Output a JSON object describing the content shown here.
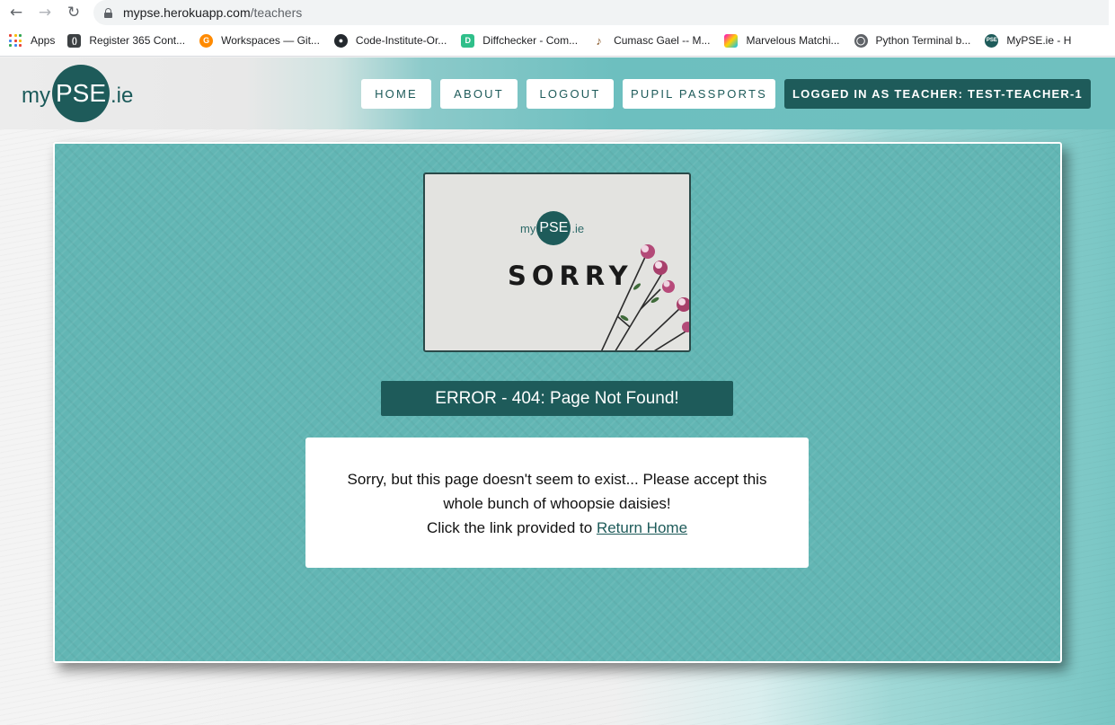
{
  "browser": {
    "url_host": "mypse.herokuapp.com",
    "url_path": "/teachers",
    "bookmarks": [
      {
        "label": "Apps",
        "icon": "apps-grid-icon"
      },
      {
        "label": "Register 365 Cont...",
        "icon": "register-icon"
      },
      {
        "label": "Workspaces — Git...",
        "icon": "gitpod-icon"
      },
      {
        "label": "Code-Institute-Or...",
        "icon": "github-icon"
      },
      {
        "label": "Diffchecker - Com...",
        "icon": "diffchecker-icon"
      },
      {
        "label": "Cumasc Gael -- M...",
        "icon": "banjo-icon"
      },
      {
        "label": "Marvelous Matchi...",
        "icon": "colorful-cube-icon"
      },
      {
        "label": "Python Terminal b...",
        "icon": "globe-icon"
      },
      {
        "label": "MyPSE.ie - H",
        "icon": "mypse-favicon-icon"
      }
    ]
  },
  "header": {
    "logo_my": "my",
    "logo_pse": "PSE",
    "logo_ie": ".ie",
    "nav": [
      {
        "label": "HOME"
      },
      {
        "label": "ABOUT"
      },
      {
        "label": "LOGOUT"
      },
      {
        "label": "PUPIL PASSPORTS"
      },
      {
        "label": "LOGGED IN AS TEACHER: TEST-TEACHER-1"
      }
    ]
  },
  "main": {
    "image": {
      "logo_my": "my",
      "logo_pse": "PSE",
      "logo_ie": ".ie",
      "caption": "SORRY"
    },
    "error_title": "ERROR - 404: Page Not Found!",
    "message_line1": "Sorry, but this page doesn't seem to exist... Please accept this",
    "message_line2": "whole bunch of whoopsie daisies!",
    "message_line3_prefix": "Click the link provided to ",
    "return_link": "Return Home"
  },
  "colors": {
    "brand_dark": "#1e5b5a",
    "card_teal": "#62b6b4"
  }
}
